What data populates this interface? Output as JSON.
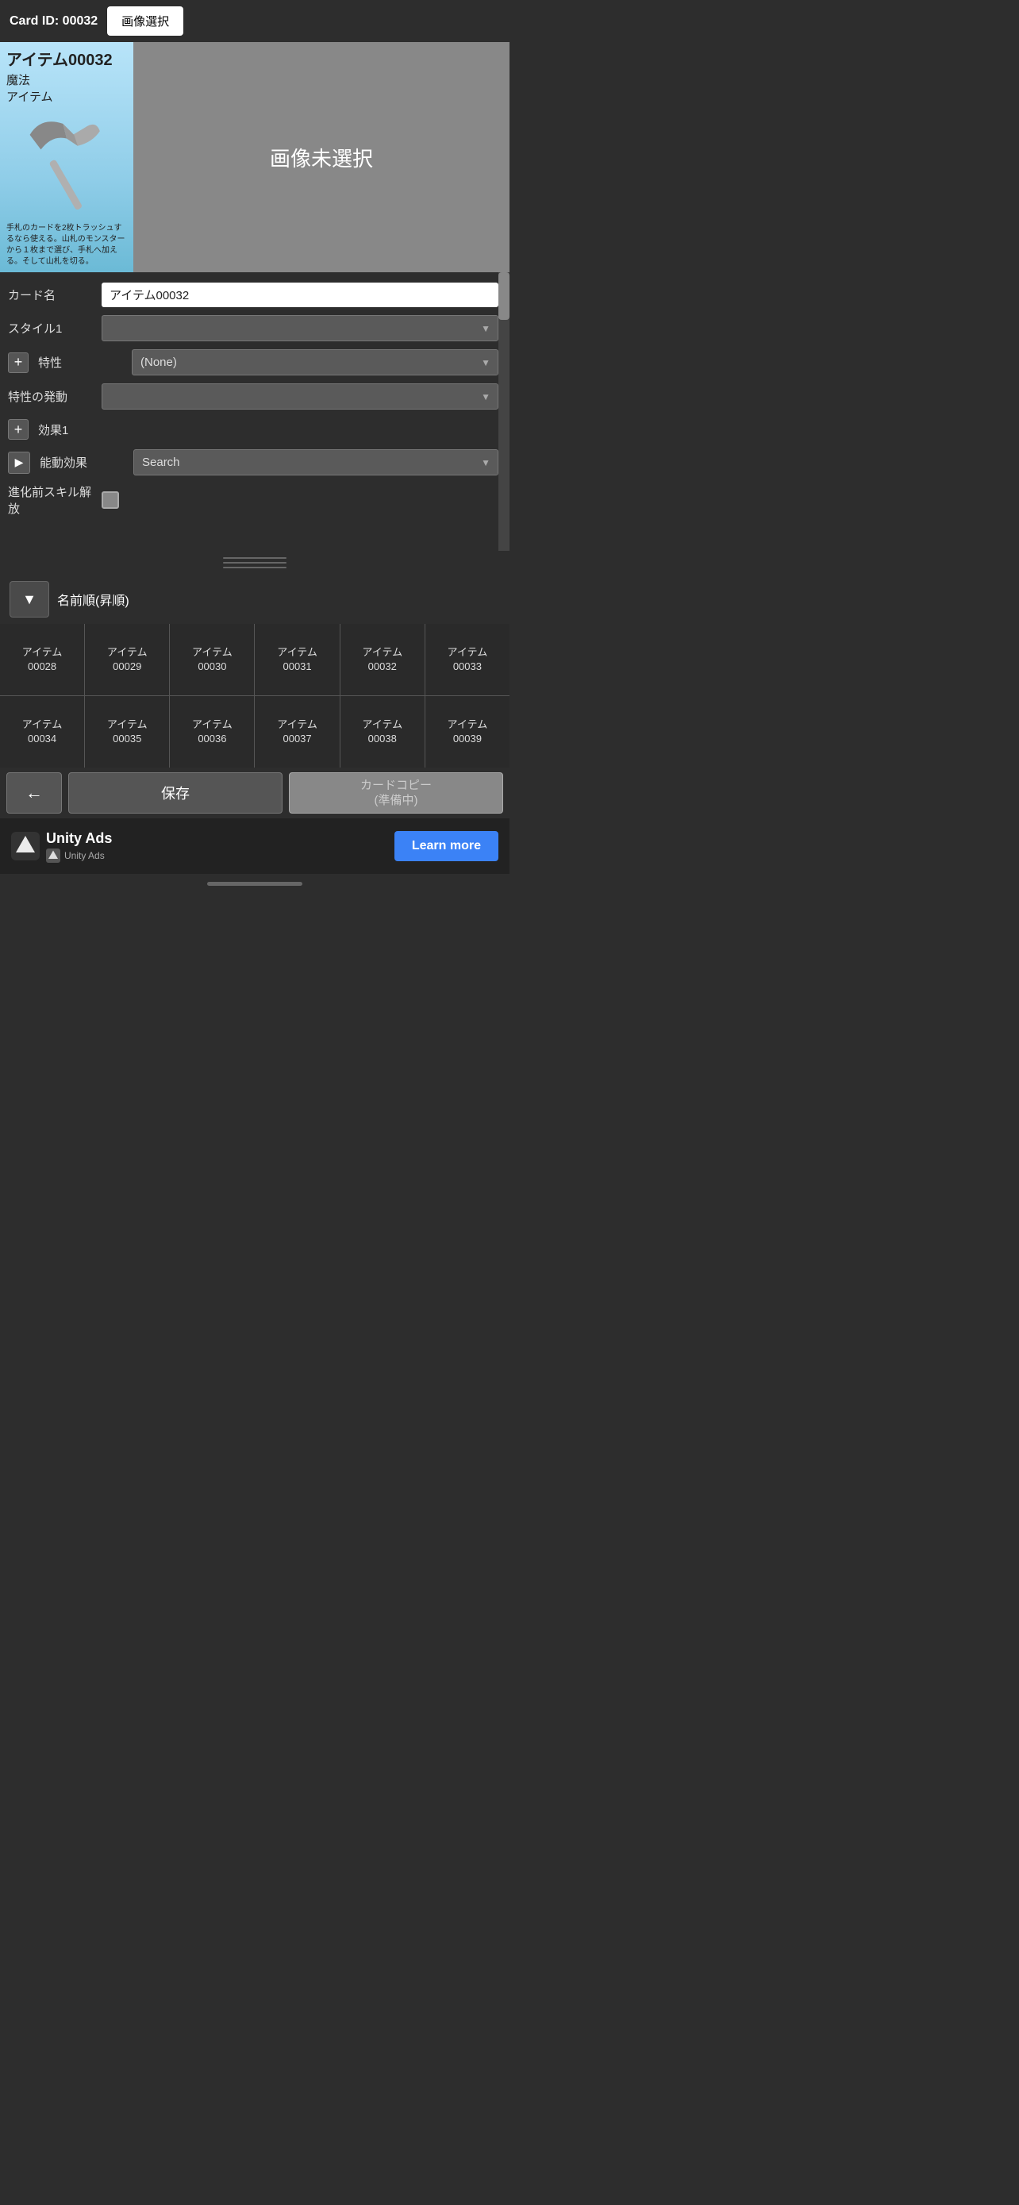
{
  "header": {
    "card_id_label": "Card ID: 00032",
    "select_image_btn": "画像選択"
  },
  "card_preview": {
    "title": "アイテム00032",
    "type1": "魔法",
    "type2": "アイテム",
    "description": "手札のカードを2枚トラッシュするなら使える。山札のモンスターから１枚まで選び、手札へ加える。そして山札を切る。",
    "no_image_text": "画像未選択"
  },
  "form": {
    "card_name_label": "カード名",
    "card_name_value": "アイテム00032",
    "style1_label": "スタイル1",
    "style1_value": "",
    "trait_label": "特性",
    "trait_value": "(None)",
    "trait_trigger_label": "特性の発動",
    "trait_trigger_value": "",
    "effect1_label": "効果1",
    "passive_effect_label": "能動効果",
    "passive_effect_placeholder": "Search",
    "skill_release_label": "進化前スキル解放"
  },
  "sort": {
    "sort_label": "名前順(昇順)",
    "sort_btn_icon": "▼"
  },
  "grid": {
    "rows": [
      [
        {
          "line1": "アイテム",
          "line2": "00028"
        },
        {
          "line1": "アイテム",
          "line2": "00029"
        },
        {
          "line1": "アイテム",
          "line2": "00030"
        },
        {
          "line1": "アイテム",
          "line2": "00031"
        },
        {
          "line1": "アイテム",
          "line2": "00032"
        },
        {
          "line1": "アイテム",
          "line2": "00033"
        }
      ],
      [
        {
          "line1": "アイテム",
          "line2": "00034"
        },
        {
          "line1": "アイテム",
          "line2": "00035"
        },
        {
          "line1": "アイテム",
          "line2": "00036"
        },
        {
          "line1": "アイテム",
          "line2": "00037"
        },
        {
          "line1": "アイテム",
          "line2": "00038"
        },
        {
          "line1": "アイテム",
          "line2": "00039"
        }
      ]
    ]
  },
  "buttons": {
    "back_icon": "←",
    "save_label": "保存",
    "copy_label": "カードコピー\n(準備中)"
  },
  "ads": {
    "unity_ads_label": "Unity Ads",
    "unity_ads_sub": "Unity  Ads",
    "learn_more_label": "Learn more"
  }
}
